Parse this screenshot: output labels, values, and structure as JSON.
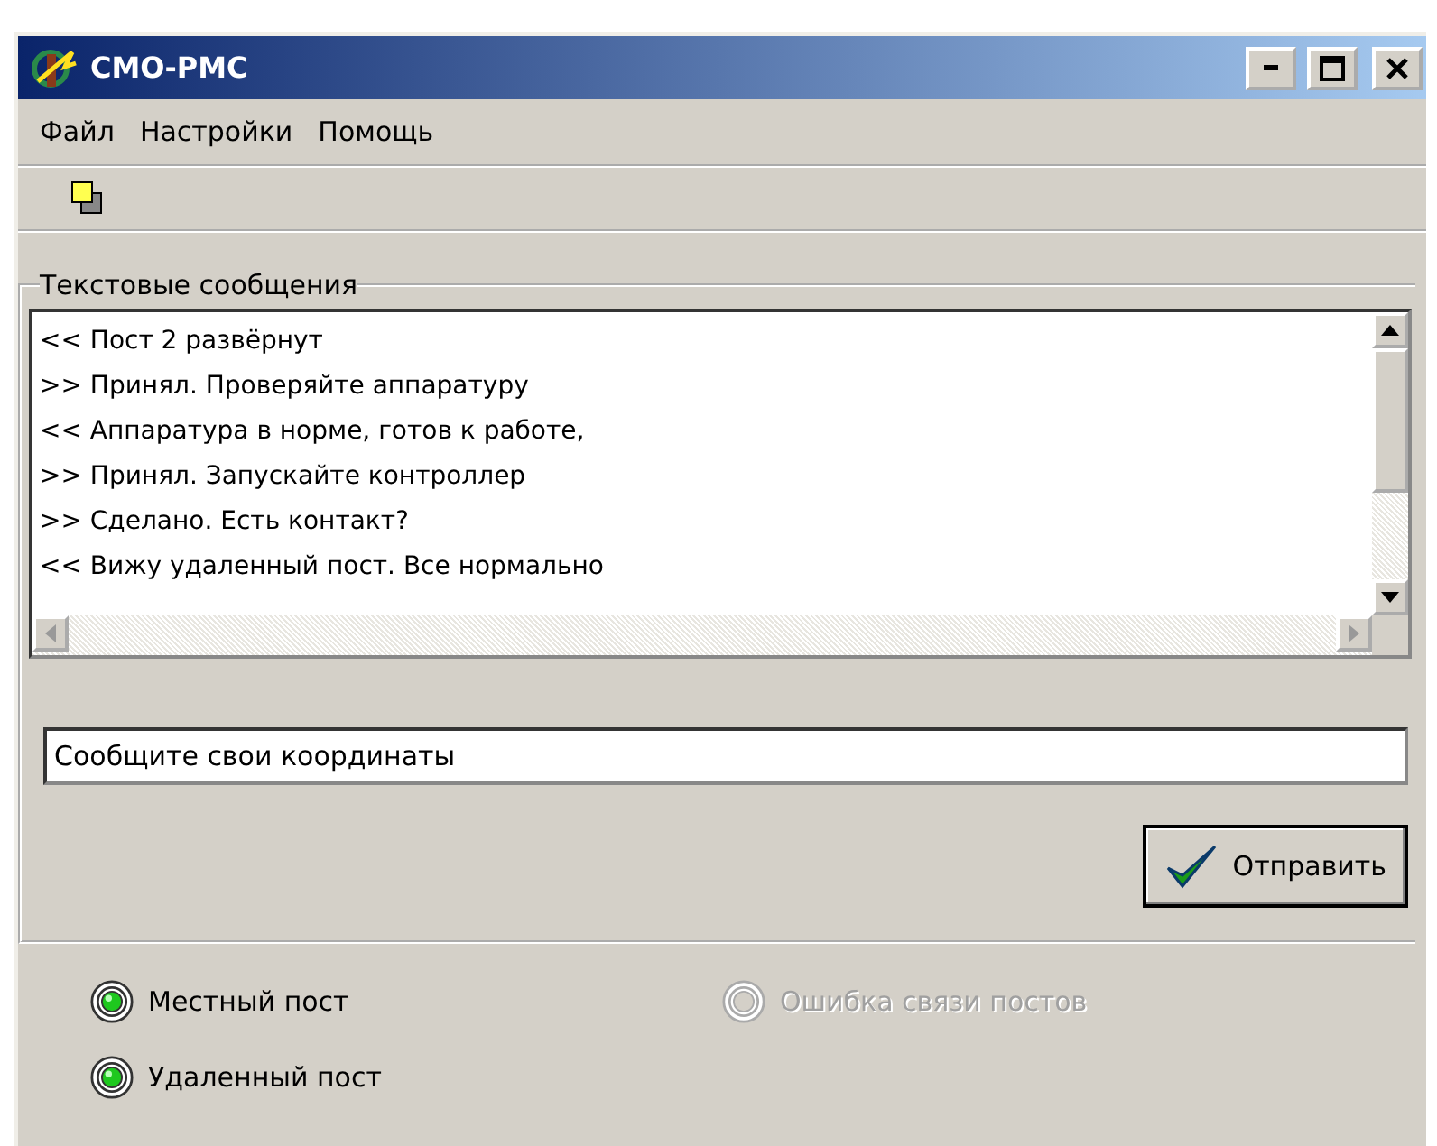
{
  "window": {
    "title": "СМО-РМС"
  },
  "menu": [
    "Файл",
    "Настройки",
    "Помощь"
  ],
  "messages_group": {
    "title": "Текстовые сообщения",
    "lines": [
      "<< Пост 2 развёрнут",
      ">> Принял. Проверяйте аппаратуру",
      "<< Аппаратура в норме, готов к работе,",
      ">> Принял. Запускайте контроллер",
      ">> Сделано. Есть контакт?",
      "<< Вижу удаленный пост. Все нормально"
    ],
    "input": {
      "value": "Сообщите свои координаты"
    },
    "send_button": "Отправить"
  },
  "indicators": [
    {
      "label": "Местный пост",
      "on": true
    },
    {
      "label": "Ошибка связи постов",
      "on": false
    },
    {
      "label": "Удаленный пост",
      "on": true
    }
  ]
}
